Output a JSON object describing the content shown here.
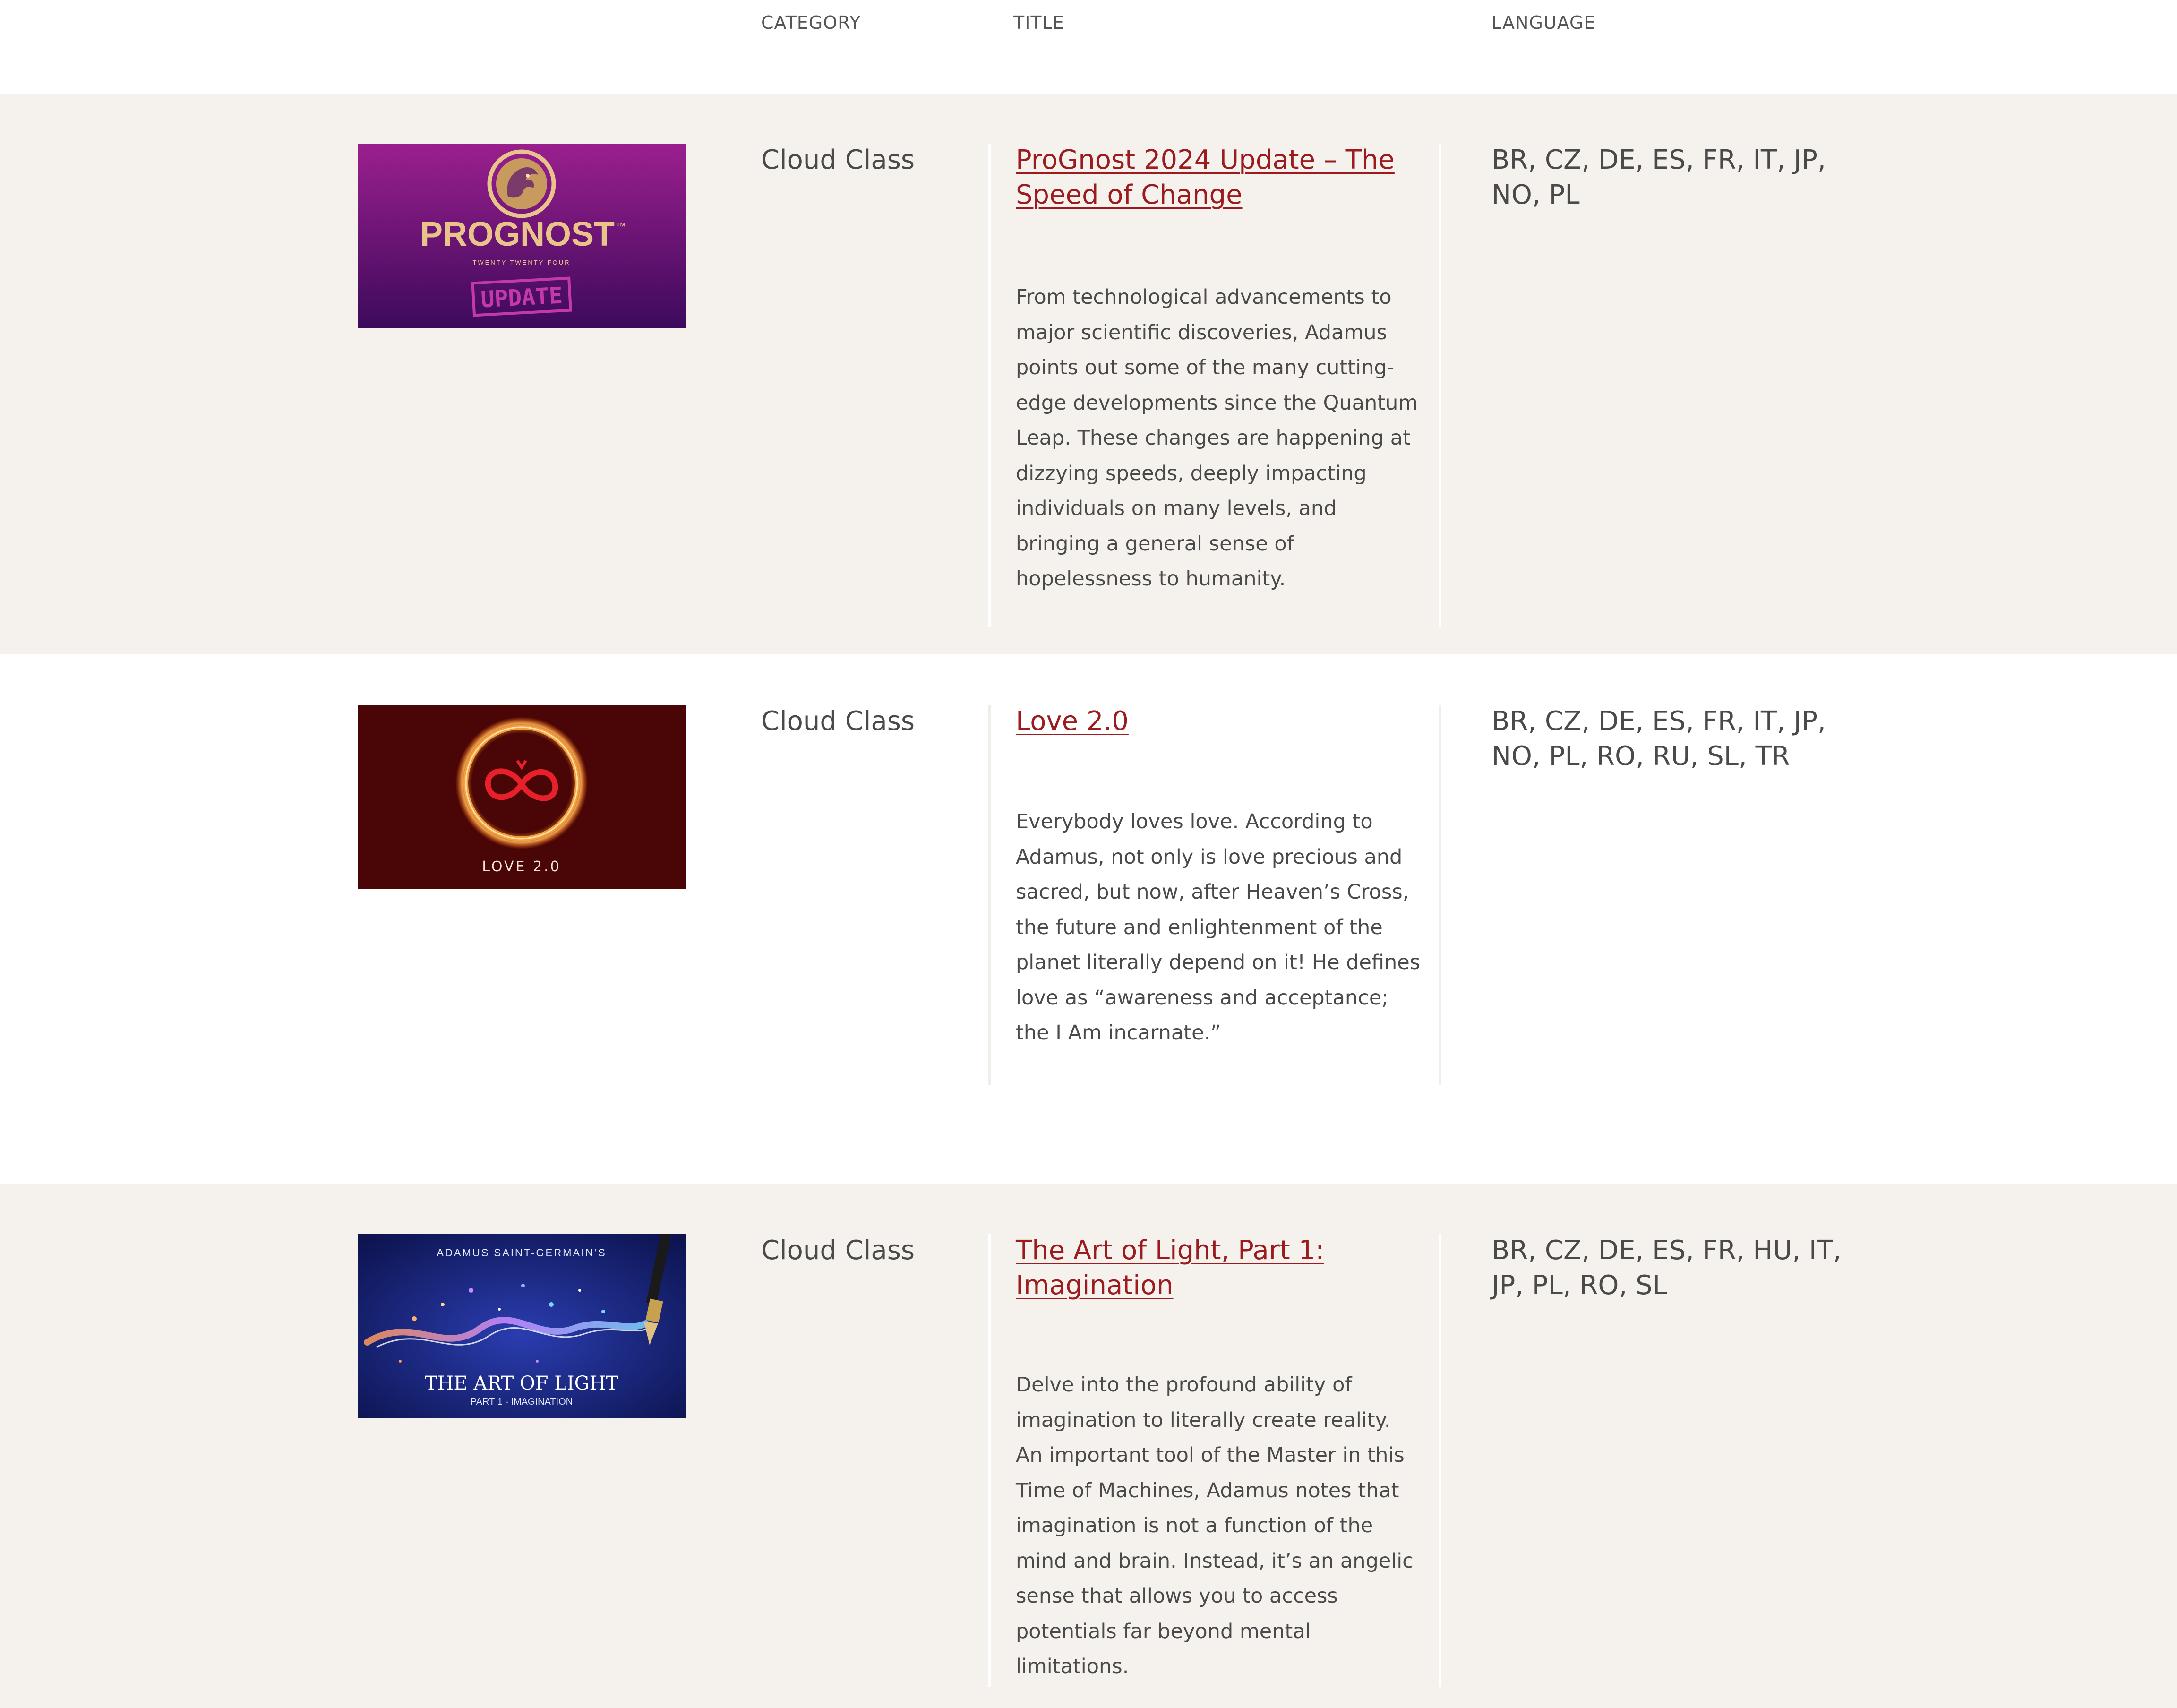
{
  "header": {
    "category": "CATEGORY",
    "title": "TITLE",
    "language": "LANGUAGE"
  },
  "rows": [
    {
      "category": "Cloud Class",
      "title": "ProGnost 2024 Update – The Speed of Change",
      "description": "From technological advancements to major scientific discoveries, Adamus points out some of the many cutting-edge developments since the Quantum Leap. These changes are happening at dizzying speeds, deeply impacting individuals on many levels, and bringing a general sense of hopelessness to humanity.",
      "languages": "BR, CZ, DE, ES, FR, IT, JP, NO, PL",
      "thumbnail": {
        "icon": "dragon-emblem-icon",
        "brand": "PROGNOST",
        "trademark": "™",
        "subtitle": "TWENTY TWENTY FOUR",
        "stamp": "UPDATE",
        "colors": {
          "top": "#9b1f8e",
          "bottom": "#3d0a5c",
          "gold": "#e8c48a"
        }
      }
    },
    {
      "category": "Cloud Class",
      "title": "Love 2.0",
      "description": "Everybody loves love. According to Adamus, not only is love precious and sacred, but now, after Heaven’s Cross, the future and enlightenment of the planet literally depend on it! He defines love as “awareness and acceptance; the I Am incarnate.”",
      "languages": "BR, CZ, DE, ES, FR, IT, JP, NO, PL, RO, RU, SL, TR",
      "thumbnail": {
        "icon": "infinity-hearts-ring-icon",
        "label": "LOVE 2.0",
        "colors": {
          "background": "#4a0606",
          "ring": "#f0a040",
          "heart": "#e8202a"
        }
      }
    },
    {
      "category": "Cloud Class",
      "title": "The Art of Light, Part 1: Imagination",
      "description": "Delve into the profound ability of imagination to literally create reality. An important tool of the Master in this Time of Machines, Adamus notes that imagination is not a function of the mind and brain. Instead, it’s an angelic sense that allows you to access potentials far beyond mental limitations.",
      "languages": "BR, CZ, DE, ES, FR, HU, IT, JP, PL, RO, SL",
      "thumbnail": {
        "icon": "paintbrush-light-icon",
        "overline": "ADAMUS SAINT-GERMAIN’S",
        "label": "THE ART OF LIGHT",
        "sublabel": "PART 1 - IMAGINATION",
        "colors": {
          "background": "#141d6b",
          "sparkle": "#7fd4ff",
          "warm": "#ff9a5a"
        }
      }
    }
  ],
  "colors": {
    "link": "#9b1b1f",
    "text": "#4a4a4a",
    "beige_row": "#f5f2ee"
  }
}
